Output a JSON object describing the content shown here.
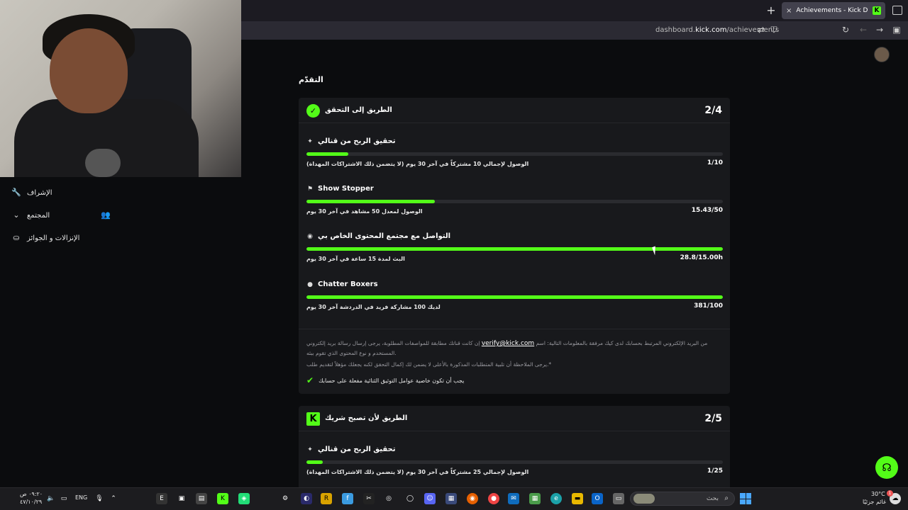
{
  "browser": {
    "tab_title": "Achievements - Kick Dashboard",
    "tab_close": "×",
    "new_tab": "+",
    "url_host": "dashboard.",
    "url_domain": "kick.com",
    "url_path": "/achievements",
    "kick_letter": "K"
  },
  "sidebar": {
    "items": [
      {
        "label": "الإشراف",
        "icon": "wrench-icon",
        "glyph": "🔧"
      },
      {
        "label": "المجتمع",
        "icon": "chevron-down-icon",
        "glyph": "⌄"
      },
      {
        "label": "الإنزالات و الجوائز",
        "icon": "gift-drops-icon",
        "glyph": "⛀"
      }
    ],
    "people_glyph": "👥"
  },
  "page": {
    "title": "التقدّم"
  },
  "card1": {
    "title": "الطريق إلى التحقق",
    "progress": "2/4",
    "badge_glyph": "✓",
    "tasks": [
      {
        "name": "تحقيق الربح من قنالي",
        "glyph": "✦",
        "desc": "الوصول لإجمالي 10 مشتركاً في آخر 30 يوم (لا يتضمن ذلك الاشتراكات المهداة)",
        "value": "1/10",
        "fill": 0.1
      },
      {
        "name": "Show Stopper",
        "glyph": "⚑",
        "desc": "الوصول لمعدل 50 مشاهد في آخر 30 يوم",
        "value": "15.43/50",
        "fill": 0.3086
      },
      {
        "name": "التواصل مع مجتمع المحتوى الخاص بي",
        "glyph": "◉",
        "desc": "البث لمدة 15 ساعة في آخر 30 يوم",
        "value": "28.8/15.00h",
        "fill": 1.0
      },
      {
        "name": "Chatter Boxers",
        "glyph": "●",
        "desc": "لديك 100 مشاركة فريد في الدردشة آخر 30 يوم",
        "value": "381/100",
        "fill": 1.0
      }
    ],
    "info_pre": "إن كانت قناتك مطابقة للمواصفات المطلوبة، يرجى إرسال رسالة بريد إلكتروني",
    "info_email": "verify@kick.com",
    "info_post": "من البريد الإلكتروني المرتبط بحسابك لدى كيك مرفقة بالمعلومات التالية: اسم المستخدم و نوع المحتوى الذي تقوم ببثه.",
    "note": "يرجى الملاحظة أن تلبية المتطلبات المذكورة بالأعلى لا يضمن لك إكمال التحقق لكنه يجعلك مؤهلاً لتقديم طلب.*",
    "requirement": "يجب أن تكون خاصية عوامل التوثيق الثنائية مفعلة على حسابك",
    "check_glyph": "✔"
  },
  "card2": {
    "title": "الطريق لأن تصبح شريك",
    "progress": "2/5",
    "badge_glyph": "K",
    "tasks": [
      {
        "name": "تحقيق الربح من قنالي",
        "glyph": "✦",
        "desc": "الوصول لإجمالي 25 مشتركاً في آخر 30 يوم (لا يتضمن ذلك الاشتراكات المهداة)",
        "value": "1/25",
        "fill": 0.04
      }
    ]
  },
  "help_glyph": "☊",
  "taskbar": {
    "time": "٠٩:٢٠ ص",
    "date": "٤٧/١٠/٢٩",
    "lang": "ENG",
    "search_placeholder": "بحث",
    "weather_temp": "30°C",
    "weather_desc": "غائم جزئيًا",
    "notif_count": "1",
    "tray_icons": [
      "speaker-icon",
      "monitor-icon",
      "mic-icon",
      "chevron-up-icon"
    ],
    "apps": [
      "epic-games-icon",
      "terminal-icon",
      "display-icon",
      "kick-app-icon",
      "spotify-like-icon",
      "settings-icon",
      "vpn-icon",
      "raid-icon",
      "files-icon",
      "capcut-icon",
      "steam-icon",
      "discord-icon",
      "manager-icon",
      "firefox-icon",
      "chrome-icon",
      "mail-icon",
      "store-icon",
      "edge-icon",
      "explorer-icon",
      "outlook-icon",
      "window-icon"
    ]
  }
}
